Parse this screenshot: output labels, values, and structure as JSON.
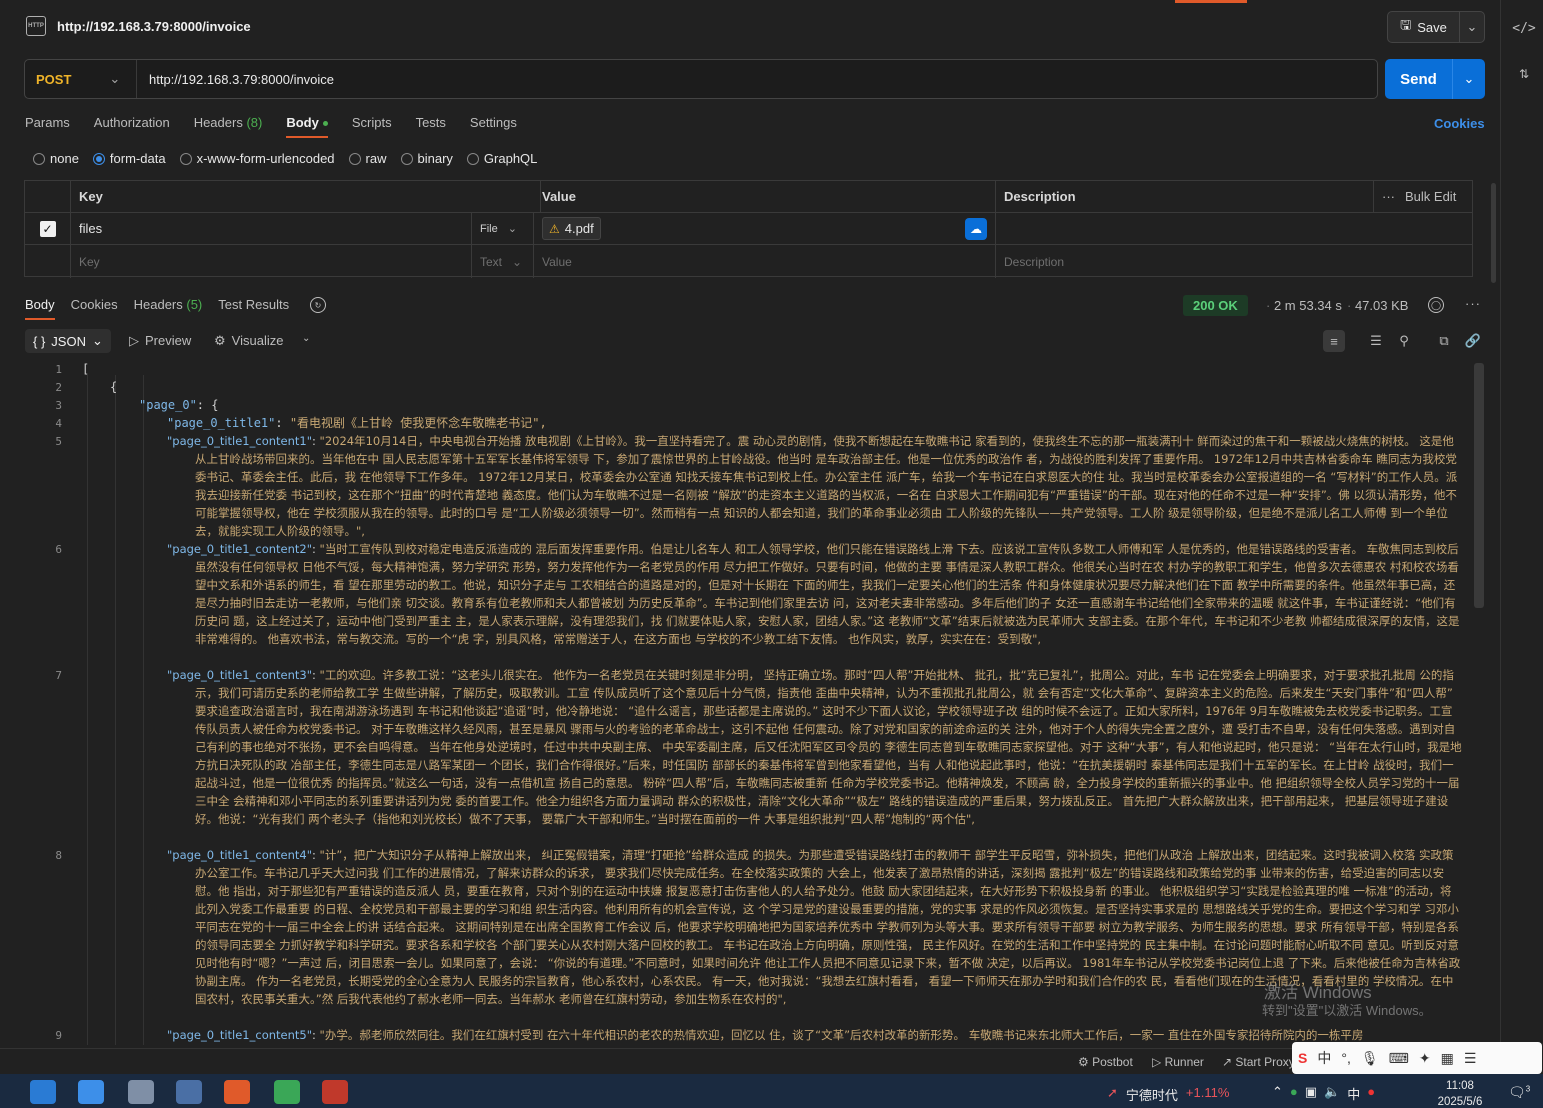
{
  "header": {
    "title": "http://192.168.3.79:8000/invoice",
    "save_label": "Save"
  },
  "request": {
    "method": "POST",
    "url": "http://192.168.3.79:8000/invoice",
    "send_label": "Send"
  },
  "tabs": [
    {
      "label": "Params"
    },
    {
      "label": "Authorization"
    },
    {
      "label": "Headers",
      "count": "(8)"
    },
    {
      "label": "Body"
    },
    {
      "label": "Scripts"
    },
    {
      "label": "Tests"
    },
    {
      "label": "Settings"
    }
  ],
  "cookies_label": "Cookies",
  "body_types": [
    "none",
    "form-data",
    "x-www-form-urlencoded",
    "raw",
    "binary",
    "GraphQL"
  ],
  "kv_table": {
    "headers": {
      "key": "Key",
      "value": "Value",
      "description": "Description",
      "bulk_edit": "Bulk Edit"
    },
    "rows": [
      {
        "key": "files",
        "type": "File",
        "value": "4.pdf"
      }
    ],
    "placeholder": {
      "key": "Key",
      "type": "Text",
      "value": "Value",
      "description": "Description"
    }
  },
  "response": {
    "tabs": [
      {
        "label": "Body"
      },
      {
        "label": "Cookies"
      },
      {
        "label": "Headers",
        "count": "(5)"
      },
      {
        "label": "Test Results"
      }
    ],
    "status": "200 OK",
    "time": "2 m 53.34 s",
    "size": "47.03 KB",
    "format": "JSON",
    "preview_label": "Preview",
    "visualize_label": "Visualize"
  },
  "code": {
    "line_numbers": [
      "1",
      "2",
      "3",
      "4",
      "5",
      "6",
      "7",
      "8",
      "9"
    ],
    "l1": "[",
    "l2": "{",
    "l3_key": "\"page_0\"",
    "l3_rest": ": {",
    "l4_key": "\"page_0_title1\"",
    "l4_val": "\"看电视剧《上甘岭 使我更怀念车敬瞧老书记\",",
    "l5_key": "\"page_0_title1_content1\"",
    "l5_val": "\"2024年10月14日，中央电视台开始播 放电视剧《上甘岭》。我一直坚持看完了。震 动心灵的剧情，使我不断想起在车敬瞧书记 家看到的，使我终生不忘的那一瓶装满刊十 鲜而染过的焦干和一颗被战火烧焦的树枝。 这是他从上甘岭战场带回来的。当年他在中 国人民志愿军第十五军军长基伟将军领导 下，参加了震惊世界的上甘岭战役。他当时 是车政治部主任。他是一位优秀的政治作 者，为战役的胜利发挥了重要作用。 1972年12月中共吉林省委命车 瞧同志为我校党委书记、革委会主任。此后，我 在他领导下工作多年。 1972年12月某日，校革委会办公室通 知找夭接车焦书记到校上任。办公室主任 派广车，给我一个车书记在白求恩医大的住 址。我当时是校革委会办公室报道组的一名 “写材料”的工作人员。派我去迎接新任党委 书记到校，这在那个“扭曲”的时代青楚地 義态度。他们认为车敬瞧不过是一名刚被 “解放”的走资本主义道路的当权派，一名在 白求恩大工作期间犯有“严重错误”的干部。现在对他的任命不过是一种“安排”。佛 以须认清形势，他不可能掌握领导权，他在 学校须服从我在的领导。此时的口号 是“工人阶级必须领导一切”。然而稍有一点 知识的人都会知道，我们的革命事业必须由 工人阶级的先锋队——共产党领导。工人阶 级是领导阶级，但是绝不是派儿名工人师傅 到一个单位去，就能实现工人阶级的领导。\",",
    "l6_key": "\"page_0_title1_content2\"",
    "l6_val": "\"当时工宣传队到校对稳定电造反派造成的 混后面发挥重要作用。伯是让儿名车人 和工人领导学校，他们只能在错误路线上滑 下去。应该说工宣传队多数工人师傅和军 人是优秀的，他是错误路线的受害者。 车敬焦同志到校后虽然没有任何领导权 日他不气馁，每大精神饱满，努力学研究 形势，努力发挥他作为一名老党员的作用 尽力把工作做好。只要有时间，他做的主要 事情是深人教职工群众。他很关心当时在农 村办学的教职工和学生，他曾多次去德惠农 村和校农场看望中文系和外语系的师生，看 望在那里劳动的教工。他说，知识分子走与 工农相结合的道路是对的，但是对十长期在 下面的师生，我我们一定要关心他们的生活条 件和身体健康状况要尽力解决他们在下面 教学中所需要的条件。他虽然年事已高，还 是尽力抽时旧去走访一老教师，与他们亲 切交谈。教育系有位老教师和夫人都曾被划 为历史反革命”。车书记到他们家里去访 问，这对老夫妻非常感动。多年后他们的子 女还一直感谢车书记给他们全家带来的温暖 就这件事，车书证谨经说：“他们有历史问 题，这上经过关了，运动中他门受到严重主 主，是人家表示理解，没有理怨我们，找 们就要体贴人家，安慰人家，团结人家。”这 老教师“文革”结束后就被选为民革师大 支部主委。在那个年代，车书记和不少老教 帅都结成很深厚的友情，这是非常难得的。 他喜欢书法，常与教交流。写的一个“虎 字，别具风格，常常赠送于人，在这方面也 与学校的不少教工结下友情。 也作风实，敦厚，实实在在：受到敬\",",
    "l7_key": "\"page_0_title1_content3\"",
    "l7_val": "\"工的欢迎。许多教工说：“这老头儿很实在。 他作为一名老党员在关键时刻是非分明， 坚持正确立场。那时“四人帮”开始批林、 批孔，批“克已复礼”，批周公。对此，车书 记在党委会上明确要求，对于要求批孔批周 公的指示，我们可请历史系的老师给教工学 生做些讲解，了解历史，吸取教训。工宣 传队成员听了这个意见后十分气愤，指责他 歪曲中央精神，认为不重视批孔批周公，就 会有否定“文化大革命”、复辟资本主义的危险。后来发生“天安门事件”和“四人帮” 要求追查政治谣言时，我在南湖游泳场遇到 车书记和他谈起“追谣”时，他冷静地说： “追什么谣言，那些话都是主席说的。” 这时不少下面人议论，学校领导班子改 组的时候不会远了。正如大家所料，1976年 9月车敬瞧被免去校党委书记职务。工宣 传队员责人被任命为校党委书记。 对于车敬瞧这样久经风雨，甚至是暴风 骤雨与火的考验的老革命战士，这引不起他 任何震动。除了对党和国家的前途命运的关 注外，他对于个人的得失完全置之度外，遭 受打击不自卑，没有任何失落感。遇到对自 己有利的事也绝对不张扬，更不会自鸣得意。 当年在他身处逆境时，任过中共中央副主席、 中央军委副主席，后又任沈阳军区司令员的 李德生同志曾到车敬瞧同志家探望他。对于 这种“大事”，有人和他说起时，他只是说： “当年在太行山时，我是地方抗日决死队的政 冶部主任，李德生同志是八路军某团一 个团长，我们合作得很好。”后来，时任国防 部部长的秦基伟将军曾到他家看望他，当有 人和他说起此事时，他说：“在抗美援朝时 秦基伟同志是我们十五军的军长。在上甘岭 战役时，我们一起战斗过，他是一位很优秀 的指挥员。”就这么一句话，没有一点借机宣 扬自己的意思。 粉碎“四人帮”后，车敬瞧同志被重新 任命为学校党委书记。他精神焕发，不顾高 龄，全力投身学校的重新振兴的事业中。他 把组织领导全校人员学习党的十一届三中全 会精神和邓小平同志的系列重要讲话列为党 委的首要工作。他全力组织各方面力量调动 群众的积极性，清除“文化大革命”“极左” 路线的错误造成的严重后果，努力拨乱反正。 首先把广大群众解放出来，把干部用起来， 把基层领导班子建设好。他说：“光有我们 两个老头子（指他和刘光校长）做不了天事， 要靠广大干部和师生。”当时摆在面前的一件 大事是组织批判“四人帮”炮制的“两个估\",",
    "l8_key": "\"page_0_title1_content4\"",
    "l8_val": "\"计”，把广大知识分子从精神上解放出来， 纠正冤假错案，清理“打砸抢”给群众造成 的损失。为那些遭受错误路线打击的教师干 部学生平反昭雪，弥补损失，把他们从政治 上解放出来，团结起来。这时我被调入校落 实政策办公室工作。车书记几乎天大过问我 们工作的进展情况，了解来访群众的诉求， 要求我们尽快完成任务。在全校落实政策的 大会上，他发表了激昂热情的讲话，深刻揭 露批判“极左”的错误路线和政策给党的事 业带来的伤害，给受迫害的同志以安慰。他 指出，对于那些犯有严重错误的造反派人 员，要重在教育，只对个别的在运动中挟嫌 报复恶意打击伤害他人的人给予处分。他鼓 励大家团结起来，在大好形势下积极投身新 的事业。 他积极组织学习“实践是检验真理的唯 一标准”的活动，将此列入党委工作最重要 的日程、全校党员和干部最主要的学习和组 织生活内容。他利用所有的机会宣传说，这 个学习是党的建设最重要的措施，党的实事 求是的作风必须恢复。是否坚持实事求是的 思想路线关乎党的生命。要把这个学习和学 习邓小平同志在党的十一届三中全会上的讲 话结合起来。 这期间特别是在出席全国教育工作会议 后，他要求学校明确地把为国家培养优秀中 学教师列为头等大事。要求所有领导干部要 树立为教学服务、为师生服务的思想。要求 所有领导干部，特别是各系的领导同志要全 力抓好教学和科学研究。要求各系和学校各 个部门要关心从农村刚大落户回校的教工。 车书记在政治上方向明确，原则性强， 民主作风好。在党的生活和工作中坚持党的 民主集中制。在讨论问题时能耐心听取不同 意见。听到反对意见时他有时“嗯？”一声过 后，闭目思索一会儿。如果同意了，会说： “你说的有道理。”不同意时，如果时间允许 他让工作人员把不同意见记录下来，暂不做 决定，以后再议。 1981年车书记从学校党委书记岗位上退 了下来。后来他被任命为吉林省政协副主席。 作为一名老党员，长期受党的全心全意为人 民服务的宗旨教育，他心系农村，心系农民。 有一天，他对我说：“我想去红旗村看看， 看望一下师师天在那办学时和我们合作的农 民，看看他们现在的生活情况，看看村里的 学校情况。在中国农村，农民事关重大。”然 后我代表他约了郝水老师一同去。当年郝水 老师曾在红旗村劳动，参加生物系在农村的\",",
    "l9_key": "\"page_0_title1_content5\"",
    "l9_val": "\"办学。郝老师欣然同往。我们在红旗村受到 在六十年代相识的老农的热情欢迎，回忆以 住，谈了“文革”后农村改革的新形势。 车敬瞧书记来东北师大工作后，一家一 直住在外国专家招待所院内的一栋平房"
  },
  "statusbar": {
    "postbot": "Postbot",
    "runner": "Runner",
    "proxy": "Start Proxy"
  },
  "watermark": {
    "line1": "激活 Windows",
    "line2": "转到\"设置\"以激活 Windows。"
  },
  "ime": {
    "logo": "S",
    "lang": "中"
  },
  "taskbar": {
    "stock_name": "宁德时代",
    "stock_change": "+1.11%",
    "tray_lang": "中",
    "time": "11:08",
    "date": "2025/5/6",
    "notif_count": "3"
  },
  "colors": {
    "accent": "#e05a2a",
    "send": "#0a6fd8",
    "method": "#f0b429",
    "ok": "#5bd07a",
    "json_key": "#7fb8e8",
    "json_string": "#c7a773"
  }
}
